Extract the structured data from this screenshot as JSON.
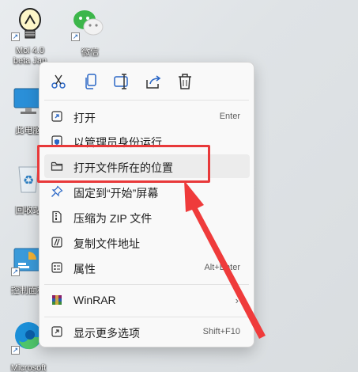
{
  "desktop": {
    "icons": [
      {
        "label_line1": "Moi 4.0",
        "label_line2": "beta Jan"
      },
      {
        "label_line1": "微信"
      },
      {
        "label_line1": "此电脑"
      },
      {
        "label_line1": "回收站"
      },
      {
        "label_line1": "控制面板"
      },
      {
        "label_line1": "Microsoft"
      }
    ]
  },
  "context_menu": {
    "toolbar": [
      "cut-icon",
      "copy-icon",
      "rename-icon",
      "share-icon",
      "delete-icon"
    ],
    "items": [
      {
        "label": "打开",
        "shortcut": "Enter",
        "icon": "open-icon"
      },
      {
        "label": "以管理员身份运行",
        "shortcut": "",
        "icon": "shield-icon"
      },
      {
        "label": "打开文件所在的位置",
        "shortcut": "",
        "icon": "folder-icon",
        "highlighted": true
      },
      {
        "label": "固定到“开始”屏幕",
        "shortcut": "",
        "icon": "pin-icon"
      },
      {
        "label": "压缩为 ZIP 文件",
        "shortcut": "",
        "icon": "zip-icon"
      },
      {
        "label": "复制文件地址",
        "shortcut": "",
        "icon": "copy-path-icon"
      },
      {
        "label": "属性",
        "shortcut": "Alt+Enter",
        "icon": "properties-icon"
      },
      {
        "label": "WinRAR",
        "shortcut": "",
        "icon": "winrar-icon",
        "submenu": true
      },
      {
        "label": "显示更多选项",
        "shortcut": "Shift+F10",
        "icon": "more-options-icon"
      }
    ]
  },
  "annotation": {
    "box_color": "#e8393a",
    "arrow_color": "#ef3b3b"
  }
}
